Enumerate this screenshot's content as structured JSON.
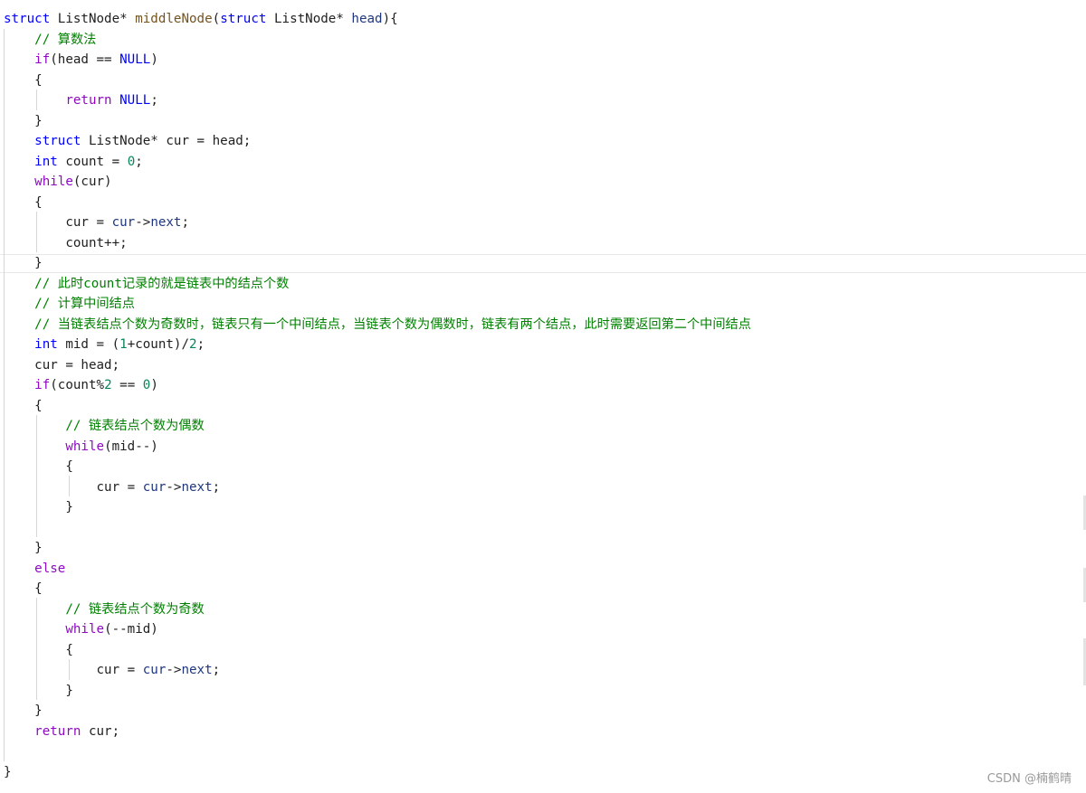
{
  "editor": {
    "language": "c",
    "lines": [
      [
        {
          "t": "struct ",
          "k": "kw"
        },
        {
          "t": "ListNode* ",
          "k": "plain"
        },
        {
          "t": "middleNode",
          "k": "fn"
        },
        {
          "t": "(",
          "k": "plain"
        },
        {
          "t": "struct ",
          "k": "kw"
        },
        {
          "t": "ListNode* ",
          "k": "plain"
        },
        {
          "t": "head",
          "k": "param"
        },
        {
          "t": "){",
          "k": "plain"
        }
      ],
      [
        {
          "t": "    ",
          "k": "plain"
        },
        {
          "t": "// 算数法",
          "k": "comment"
        }
      ],
      [
        {
          "t": "    ",
          "k": "plain"
        },
        {
          "t": "if",
          "k": "ctl"
        },
        {
          "t": "(head == ",
          "k": "plain"
        },
        {
          "t": "NULL",
          "k": "macro"
        },
        {
          "t": ")",
          "k": "plain"
        }
      ],
      [
        {
          "t": "    {",
          "k": "plain"
        }
      ],
      [
        {
          "t": "        ",
          "k": "plain"
        },
        {
          "t": "return ",
          "k": "ctl"
        },
        {
          "t": "NULL",
          "k": "macro"
        },
        {
          "t": ";",
          "k": "plain"
        }
      ],
      [
        {
          "t": "    }",
          "k": "plain"
        }
      ],
      [
        {
          "t": "    ",
          "k": "plain"
        },
        {
          "t": "struct ",
          "k": "kw"
        },
        {
          "t": "ListNode* cur = head;",
          "k": "plain"
        }
      ],
      [
        {
          "t": "    ",
          "k": "plain"
        },
        {
          "t": "int ",
          "k": "kw"
        },
        {
          "t": "count = ",
          "k": "plain"
        },
        {
          "t": "0",
          "k": "num"
        },
        {
          "t": ";",
          "k": "plain"
        }
      ],
      [
        {
          "t": "    ",
          "k": "plain"
        },
        {
          "t": "while",
          "k": "ctl"
        },
        {
          "t": "(cur)",
          "k": "plain"
        }
      ],
      [
        {
          "t": "    {",
          "k": "plain"
        }
      ],
      [
        {
          "t": "        cur = ",
          "k": "plain"
        },
        {
          "t": "cur",
          "k": "member"
        },
        {
          "t": "->",
          "k": "plain"
        },
        {
          "t": "next",
          "k": "member"
        },
        {
          "t": ";",
          "k": "plain"
        }
      ],
      [
        {
          "t": "        count++;",
          "k": "plain"
        }
      ],
      [
        {
          "t": "    }",
          "k": "plain"
        }
      ],
      [
        {
          "t": "    ",
          "k": "plain"
        },
        {
          "t": "// 此时count记录的就是链表中的结点个数",
          "k": "comment"
        }
      ],
      [
        {
          "t": "    ",
          "k": "plain"
        },
        {
          "t": "// 计算中间结点",
          "k": "comment"
        }
      ],
      [
        {
          "t": "    ",
          "k": "plain"
        },
        {
          "t": "// 当链表结点个数为奇数时，链表只有一个中间结点，当链表个数为偶数时，链表有两个结点，此时需要返回第二个中间结点",
          "k": "comment"
        }
      ],
      [
        {
          "t": "    ",
          "k": "plain"
        },
        {
          "t": "int ",
          "k": "kw"
        },
        {
          "t": "mid = (",
          "k": "plain"
        },
        {
          "t": "1",
          "k": "num"
        },
        {
          "t": "+count)/",
          "k": "plain"
        },
        {
          "t": "2",
          "k": "num"
        },
        {
          "t": ";",
          "k": "plain"
        }
      ],
      [
        {
          "t": "    cur = head;",
          "k": "plain"
        }
      ],
      [
        {
          "t": "    ",
          "k": "plain"
        },
        {
          "t": "if",
          "k": "ctl"
        },
        {
          "t": "(count%",
          "k": "plain"
        },
        {
          "t": "2",
          "k": "num"
        },
        {
          "t": " == ",
          "k": "plain"
        },
        {
          "t": "0",
          "k": "num"
        },
        {
          "t": ")",
          "k": "plain"
        }
      ],
      [
        {
          "t": "    {",
          "k": "plain"
        }
      ],
      [
        {
          "t": "        ",
          "k": "plain"
        },
        {
          "t": "// 链表结点个数为偶数",
          "k": "comment"
        }
      ],
      [
        {
          "t": "        ",
          "k": "plain"
        },
        {
          "t": "while",
          "k": "ctl"
        },
        {
          "t": "(mid--)",
          "k": "plain"
        }
      ],
      [
        {
          "t": "        {",
          "k": "plain"
        }
      ],
      [
        {
          "t": "            cur = ",
          "k": "plain"
        },
        {
          "t": "cur",
          "k": "member"
        },
        {
          "t": "->",
          "k": "plain"
        },
        {
          "t": "next",
          "k": "member"
        },
        {
          "t": ";",
          "k": "plain"
        }
      ],
      [
        {
          "t": "        }",
          "k": "plain"
        }
      ],
      [
        {
          "t": "",
          "k": "plain"
        }
      ],
      [
        {
          "t": "    }",
          "k": "plain"
        }
      ],
      [
        {
          "t": "    ",
          "k": "plain"
        },
        {
          "t": "else",
          "k": "ctl"
        }
      ],
      [
        {
          "t": "    {",
          "k": "plain"
        }
      ],
      [
        {
          "t": "        ",
          "k": "plain"
        },
        {
          "t": "// 链表结点个数为奇数",
          "k": "comment"
        }
      ],
      [
        {
          "t": "        ",
          "k": "plain"
        },
        {
          "t": "while",
          "k": "ctl"
        },
        {
          "t": "(--mid)",
          "k": "plain"
        }
      ],
      [
        {
          "t": "        {",
          "k": "plain"
        }
      ],
      [
        {
          "t": "            cur = ",
          "k": "plain"
        },
        {
          "t": "cur",
          "k": "member"
        },
        {
          "t": "->",
          "k": "plain"
        },
        {
          "t": "next",
          "k": "member"
        },
        {
          "t": ";",
          "k": "plain"
        }
      ],
      [
        {
          "t": "        }",
          "k": "plain"
        }
      ],
      [
        {
          "t": "    }",
          "k": "plain"
        }
      ],
      [
        {
          "t": "    ",
          "k": "plain"
        },
        {
          "t": "return ",
          "k": "ctl"
        },
        {
          "t": "cur;",
          "k": "plain"
        }
      ],
      [
        {
          "t": "",
          "k": "plain"
        }
      ],
      [
        {
          "t": "}",
          "k": "plain"
        }
      ]
    ]
  },
  "watermark": "CSDN @楠鹤晴"
}
